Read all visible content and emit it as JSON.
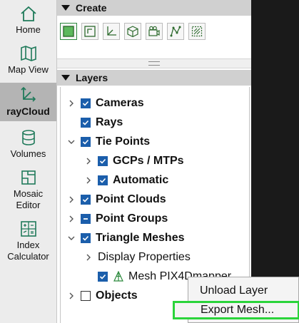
{
  "nav": {
    "items": [
      {
        "label": "Home",
        "icon": "home-icon"
      },
      {
        "label": "Map View",
        "icon": "map-icon"
      },
      {
        "label": "rayCloud",
        "icon": "axes-icon",
        "active": true
      },
      {
        "label": "Volumes",
        "icon": "cylinder-icon"
      },
      {
        "label": "Mosaic\nEditor",
        "icon": "mosaic-icon"
      },
      {
        "label": "Index\nCalculator",
        "icon": "calculator-icon"
      }
    ]
  },
  "create": {
    "title": "Create",
    "tools": [
      "new-rectangle-icon",
      "new-frame-icon",
      "axis-icon",
      "cube-icon",
      "camera-icon",
      "polyline-icon",
      "grid-square-icon"
    ]
  },
  "layers": {
    "title": "Layers",
    "rows": [
      {
        "label": "Cameras",
        "check": "checked",
        "chevron": "right",
        "bold": true
      },
      {
        "label": "Rays",
        "check": "checked",
        "chevron": "none",
        "bold": true
      },
      {
        "label": "Tie Points",
        "check": "checked",
        "chevron": "down",
        "bold": true
      },
      {
        "label": "GCPs / MTPs",
        "check": "checked",
        "chevron": "right",
        "bold": true
      },
      {
        "label": "Automatic",
        "check": "checked",
        "chevron": "right",
        "bold": true
      },
      {
        "label": "Point Clouds",
        "check": "checked",
        "chevron": "right",
        "bold": true
      },
      {
        "label": "Point Groups",
        "check": "partial",
        "chevron": "right",
        "bold": true
      },
      {
        "label": "Triangle Meshes",
        "check": "checked",
        "chevron": "down",
        "bold": true
      },
      {
        "label": "Display Properties",
        "check": "none",
        "chevron": "right",
        "bold": false
      },
      {
        "label": "Mesh PIX4Dmapper",
        "check": "checked",
        "chevron": "none",
        "bold": false
      },
      {
        "label": "Objects",
        "check": "empty",
        "chevron": "right",
        "bold": true
      }
    ]
  },
  "context_menu": {
    "items": [
      "Unload Layer",
      "Export Mesh..."
    ],
    "highlight_color": "#2ad43a"
  }
}
